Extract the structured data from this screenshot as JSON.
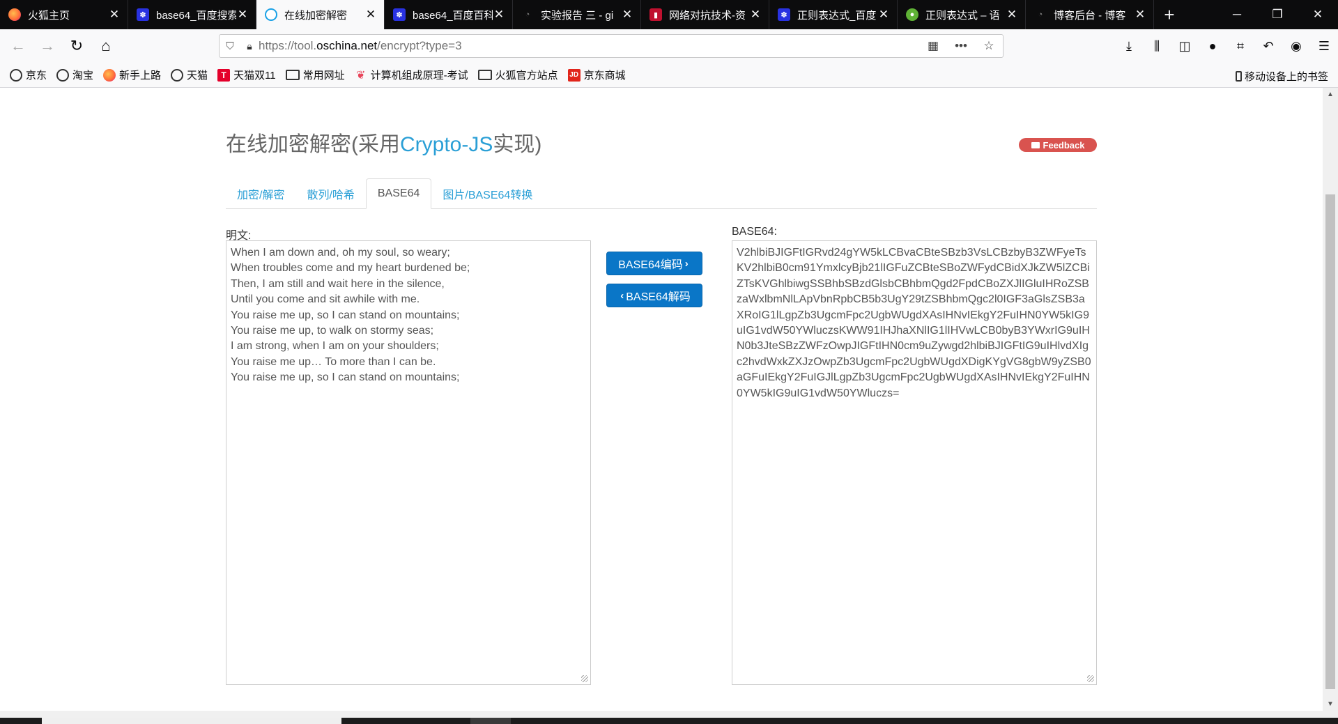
{
  "browser": {
    "tabs": [
      {
        "label": "火狐主页",
        "icon": "firefox-icon"
      },
      {
        "label": "base64_百度搜索",
        "icon": "baidu-icon"
      },
      {
        "label": "在线加密解密",
        "icon": "oschina-icon",
        "active": true
      },
      {
        "label": "base64_百度百科",
        "icon": "baidu-icon"
      },
      {
        "label": "实验报告 三 - gi",
        "icon": "github-icon"
      },
      {
        "label": "网络对抗技术-资",
        "icon": "book-icon"
      },
      {
        "label": "正则表达式_百度",
        "icon": "baidu-icon"
      },
      {
        "label": "正则表达式 – 语",
        "icon": "runoob-icon"
      },
      {
        "label": "博客后台 - 博客",
        "icon": "github-icon"
      }
    ],
    "url_prefix": "https://tool.",
    "url_domain": "oschina.net",
    "url_path": "/encrypt?type=3",
    "bookmarks": [
      {
        "label": "京东",
        "icon": "globe-icon"
      },
      {
        "label": "淘宝",
        "icon": "globe-icon"
      },
      {
        "label": "新手上路",
        "icon": "firefox-icon"
      },
      {
        "label": "天猫",
        "icon": "globe-icon"
      },
      {
        "label": "天猫双11",
        "icon": "tmall-icon"
      },
      {
        "label": "常用网址",
        "icon": "folder-icon"
      },
      {
        "label": "计算机组成原理-考试",
        "icon": "book-icon"
      },
      {
        "label": "火狐官方站点",
        "icon": "folder-icon"
      },
      {
        "label": "京东商城",
        "icon": "jd-icon"
      }
    ],
    "mobile_bookmarks": "移动设备上的书签"
  },
  "page": {
    "title_prefix": "在线加密解密(采用",
    "title_accent": "Crypto-JS",
    "title_suffix": "实现)",
    "feedback": "Feedback",
    "tabs": [
      "加密/解密",
      "散列/哈希",
      "BASE64",
      "图片/BASE64转换"
    ],
    "active_tab": "BASE64",
    "plain_label": "明文:",
    "plain_lines": [
      "When I am down and, oh my soul, so weary;",
      "When troubles come and my heart burdened be;",
      "Then, I am still and wait here in the silence,",
      "Until you come and sit awhile with me.",
      "You raise me up, so I can stand on mountains;",
      "You raise me up, to walk on stormy seas;",
      "I am strong, when I am on your shoulders;",
      "You raise me up… To more than I can be.",
      "You raise me up, so I can stand on mountains;"
    ],
    "encode_button": "BASE64编码",
    "decode_button": "BASE64解码",
    "base64_label": "BASE64:",
    "base64_value": "V2hlbiBJIGFtIGRvd24gYW5kLCBvaCBteSBzb3VsLCBzbyB3ZWFyeTsKV2hlbiB0cm91YmxlcyBjb21lIGFuZCBteSBoZWFydCBidXJkZW5lZCBiZTsKVGhlbiwgSSBhbSBzdGlsbCBhbmQgd2FpdCBoZXJlIGluIHRoZSBzaWxlbmNlLApVbnRpbCB5b3UgY29tZSBhbmQgc2l0IGF3aGlsZSB3aXRoIG1lLgpZb3UgcmFpc2UgbWUgdXAsIHNvIEkgY2FuIHN0YW5kIG9uIG1vdW50YWluczsKWW91IHJhaXNlIG1lIHVwLCB0byB3YWxrIG9uIHN0b3JteSBzZWFzOwpJIGFtIHN0cm9uZywgd2hlbiBJIGFtIG9uIHlvdXIgc2hvdWxkZXJzOwpZb3UgcmFpc2UgbWUgdXDigKYgVG8gbW9yZSB0aGFuIEkgY2FuIGJlLgpZb3UgcmFpc2UgbWUgdXAsIHNvIEkgY2FuIHN0YW5kIG9uIG1vdW50YWluczs="
  },
  "colors": {
    "accent": "#2a9fd6",
    "button": "#0a76c7",
    "feedback": "#d9534f"
  }
}
